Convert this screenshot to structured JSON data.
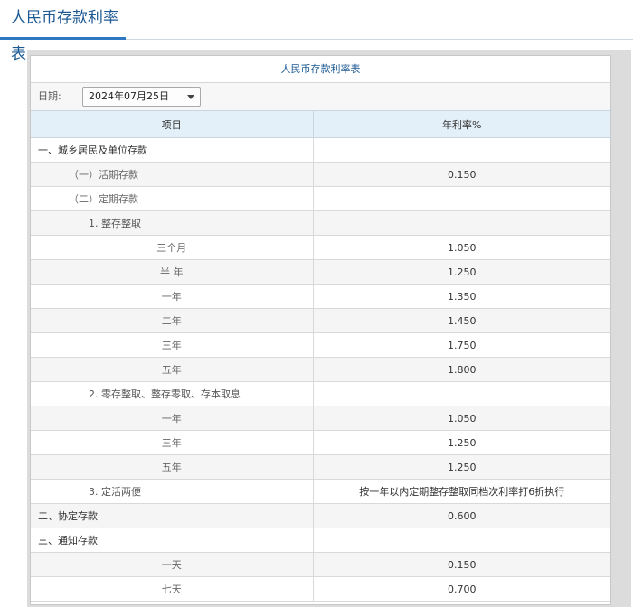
{
  "header": {
    "title": "人民币存款利率表"
  },
  "table": {
    "caption": "人民币存款利率表",
    "date_label": "日期:",
    "date_value": "2024年07月25日",
    "columns": [
      "项目",
      "年利率%"
    ],
    "rows": [
      {
        "label": "一、城乡居民及单位存款",
        "value": "",
        "level": 0
      },
      {
        "label": "（一）活期存款",
        "value": "0.150",
        "level": 1
      },
      {
        "label": "（二）定期存款",
        "value": "",
        "level": 1
      },
      {
        "label": "1. 整存整取",
        "value": "",
        "level": 2
      },
      {
        "label": "三个月",
        "value": "1.050",
        "level": 3
      },
      {
        "label": "半 年",
        "value": "1.250",
        "level": 3
      },
      {
        "label": "一年",
        "value": "1.350",
        "level": 3
      },
      {
        "label": "二年",
        "value": "1.450",
        "level": 3
      },
      {
        "label": "三年",
        "value": "1.750",
        "level": 3
      },
      {
        "label": "五年",
        "value": "1.800",
        "level": 3
      },
      {
        "label": "2. 零存整取、整存零取、存本取息",
        "value": "",
        "level": 2
      },
      {
        "label": "一年",
        "value": "1.050",
        "level": 3
      },
      {
        "label": "三年",
        "value": "1.250",
        "level": 3
      },
      {
        "label": "五年",
        "value": "1.250",
        "level": 3
      },
      {
        "label": "3. 定活两便",
        "value": "按一年以内定期整存整取同档次利率打6折执行",
        "level": 2
      },
      {
        "label": "二、协定存款",
        "value": "0.600",
        "level": 0
      },
      {
        "label": "三、通知存款",
        "value": "",
        "level": 0
      },
      {
        "label": "一天",
        "value": "0.150",
        "level": 3
      },
      {
        "label": "七天",
        "value": "0.700",
        "level": 3
      }
    ]
  }
}
